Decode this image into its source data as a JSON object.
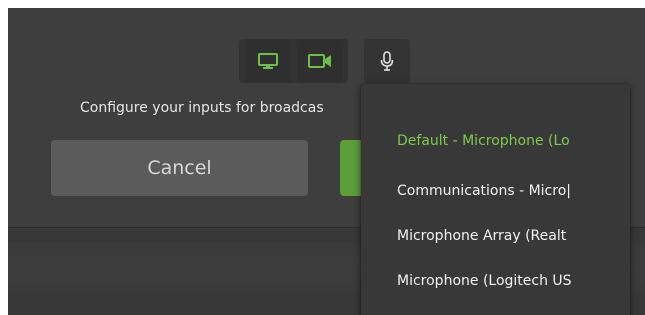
{
  "colors": {
    "accent_green": "#5c9e3a",
    "selected_text": "#7ccb4b",
    "icon_green": "#6cc04a",
    "icon_grey": "#e0e0e0"
  },
  "toolbar": {
    "screen_icon": "monitor-icon",
    "camera_icon": "video-camera-icon",
    "mic_icon": "microphone-icon"
  },
  "config": {
    "text": "Configure your inputs for broadcas"
  },
  "buttons": {
    "cancel_label": "Cancel"
  },
  "microphone_menu": {
    "selected_index": 0,
    "items": [
      {
        "label": "Default - Microphone (Lo"
      },
      {
        "label": "Communications - Micro|"
      },
      {
        "label": "Microphone Array (Realt"
      },
      {
        "label": "Microphone (Logitech US"
      }
    ]
  }
}
